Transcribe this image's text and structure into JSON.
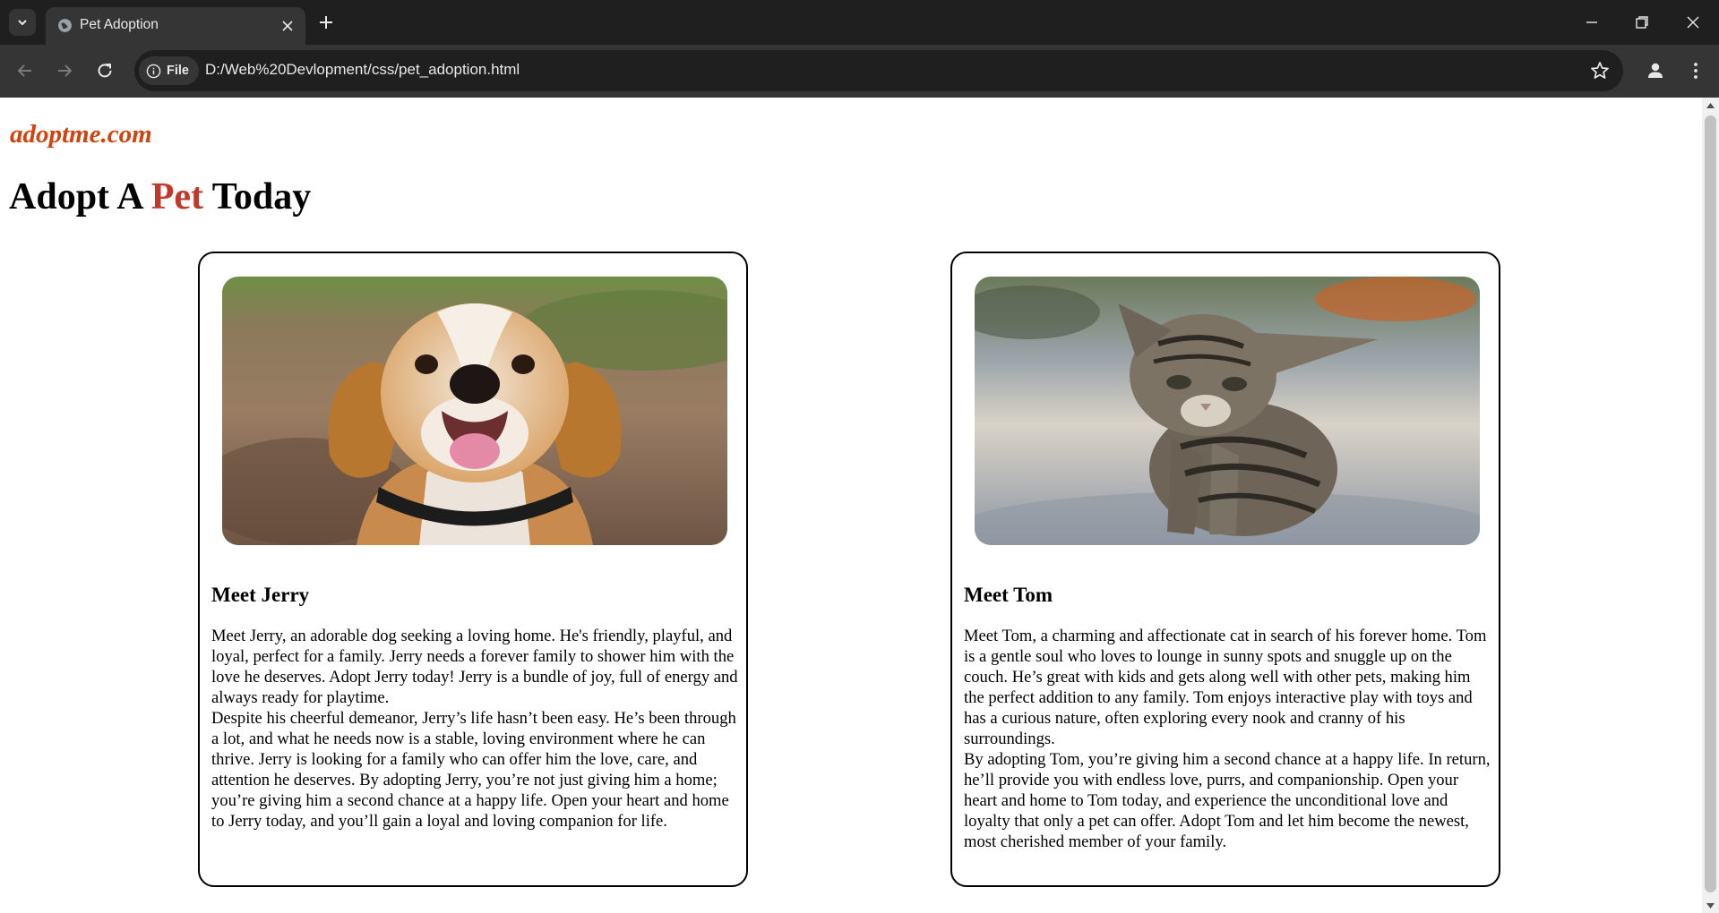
{
  "browser": {
    "tab_title": "Pet Adoption",
    "site_chip": "File",
    "url": "D:/Web%20Devlopment/css/pet_adoption.html",
    "icons": {
      "tab_search": "chevron-down-icon",
      "favicon": "globe-icon",
      "tab_close": "close-icon",
      "new_tab": "plus-icon",
      "minimize": "minimize-icon",
      "restore": "restore-icon",
      "close_window": "close-icon",
      "back": "arrow-left-icon",
      "forward": "arrow-right-icon",
      "reload": "reload-icon",
      "site_info": "info-icon",
      "bookmark": "star-icon",
      "profile": "account-icon",
      "menu": "more-vertical-icon"
    }
  },
  "page": {
    "brand": "adoptme.com",
    "headline": {
      "part1": "Adopt A ",
      "accent": "Pet",
      "part2": " Today"
    },
    "colors": {
      "brand": "#d2420e",
      "accent": "#c0392b"
    },
    "cards": [
      {
        "image_subject": "beagle dog",
        "title": "Meet Jerry",
        "paragraphs": [
          "Meet Jerry, an adorable dog seeking a loving home. He's friendly, playful, and loyal, perfect for a family. Jerry needs a forever family to shower him with the love he deserves. Adopt Jerry today! Jerry is a bundle of joy, full of energy and always ready for playtime.",
          "Despite his cheerful demeanor, Jerry’s life hasn’t been easy. He’s been through a lot, and what he needs now is a stable, loving environment where he can thrive. Jerry is looking for a family who can offer him the love, care, and attention he deserves. By adopting Jerry, you’re not just giving him a home; you’re giving him a second chance at a happy life. Open your heart and home to Jerry today, and you’ll gain a loyal and loving companion for life."
        ]
      },
      {
        "image_subject": "tabby kitten",
        "title": "Meet Tom",
        "paragraphs": [
          "Meet Tom, a charming and affectionate cat in search of his forever home. Tom is a gentle soul who loves to lounge in sunny spots and snuggle up on the couch. He’s great with kids and gets along well with other pets, making him the perfect addition to any family. Tom enjoys interactive play with toys and has a curious nature, often exploring every nook and cranny of his surroundings.",
          "By adopting Tom, you’re giving him a second chance at a happy life. In return, he’ll provide you with endless love, purrs, and companionship. Open your heart and home to Tom today, and experience the unconditional love and loyalty that only a pet can offer. Adopt Tom and let him become the newest, most cherished member of your family."
        ]
      }
    ]
  }
}
